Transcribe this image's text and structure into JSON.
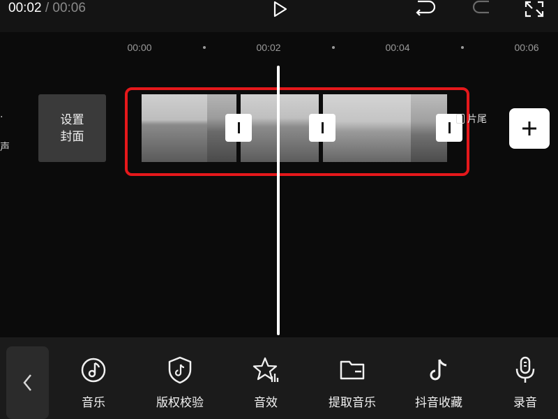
{
  "header": {
    "current_time": "00:02",
    "separator": "/",
    "total_time": "00:06"
  },
  "ruler": {
    "ticks": [
      "00:00",
      "00:02",
      "00:04",
      "00:06"
    ]
  },
  "track": {
    "cover_line1": "设置",
    "cover_line2": "封面",
    "left_partial_label": "声",
    "ending_label": "片尾"
  },
  "toolbar": {
    "items": [
      {
        "label": "音乐",
        "icon": "music-note-icon"
      },
      {
        "label": "版权校验",
        "icon": "shield-tiktok-icon"
      },
      {
        "label": "音效",
        "icon": "star-sound-icon"
      },
      {
        "label": "提取音乐",
        "icon": "folder-icon"
      },
      {
        "label": "抖音收藏",
        "icon": "tiktok-icon"
      },
      {
        "label": "录音",
        "icon": "microphone-icon"
      }
    ]
  },
  "colors": {
    "background": "#0b0b0b",
    "highlight_border": "#e5181b",
    "toolbar_bg": "#1b1b1b"
  }
}
